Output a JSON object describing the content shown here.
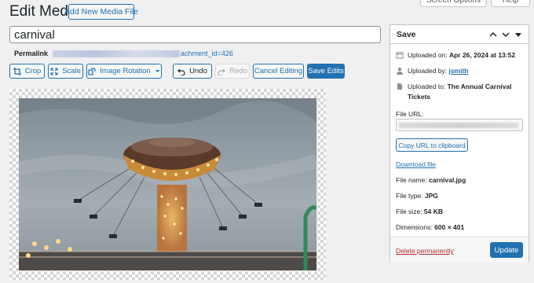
{
  "header": {
    "page_title": "Edit Media",
    "add_new_label": "Add New Media File",
    "screen_options_label": "Screen Options",
    "help_label": "Help"
  },
  "media": {
    "title_value": "carnival",
    "permalink_label": "Permalink",
    "permalink_tail": "achment_id=426"
  },
  "toolbar": {
    "crop_label": "Crop",
    "scale_label": "Scale",
    "rotation_label": "Image Rotation",
    "undo_label": "Undo",
    "redo_label": "Redo",
    "cancel_label": "Cancel Editing",
    "save_label": "Save Edits"
  },
  "panel": {
    "title": "Save",
    "uploaded_on_label": "Uploaded on:",
    "uploaded_on_value": "Apr 26, 2024 at 13:52",
    "uploaded_by_label": "Uploaded by:",
    "uploaded_by_value": "jsmith",
    "uploaded_to_label": "Uploaded to:",
    "uploaded_to_value": "The Annual Carnival Tickets",
    "file_url_label": "File URL:",
    "copy_url_label": "Copy URL to clipboard",
    "download_label": "Download file",
    "file_name_label": "File name:",
    "file_name_value": "carnival.jpg",
    "file_type_label": "File type:",
    "file_type_value": "JPG",
    "file_size_label": "File size:",
    "file_size_value": "54 KB",
    "dimensions_label": "Dimensions:",
    "dimensions_value": "600 × 401",
    "delete_label": "Delete permanently",
    "update_label": "Update"
  },
  "colors": {
    "accent": "#2271b1",
    "danger": "#b32d2e",
    "background": "#f0f0f1"
  }
}
